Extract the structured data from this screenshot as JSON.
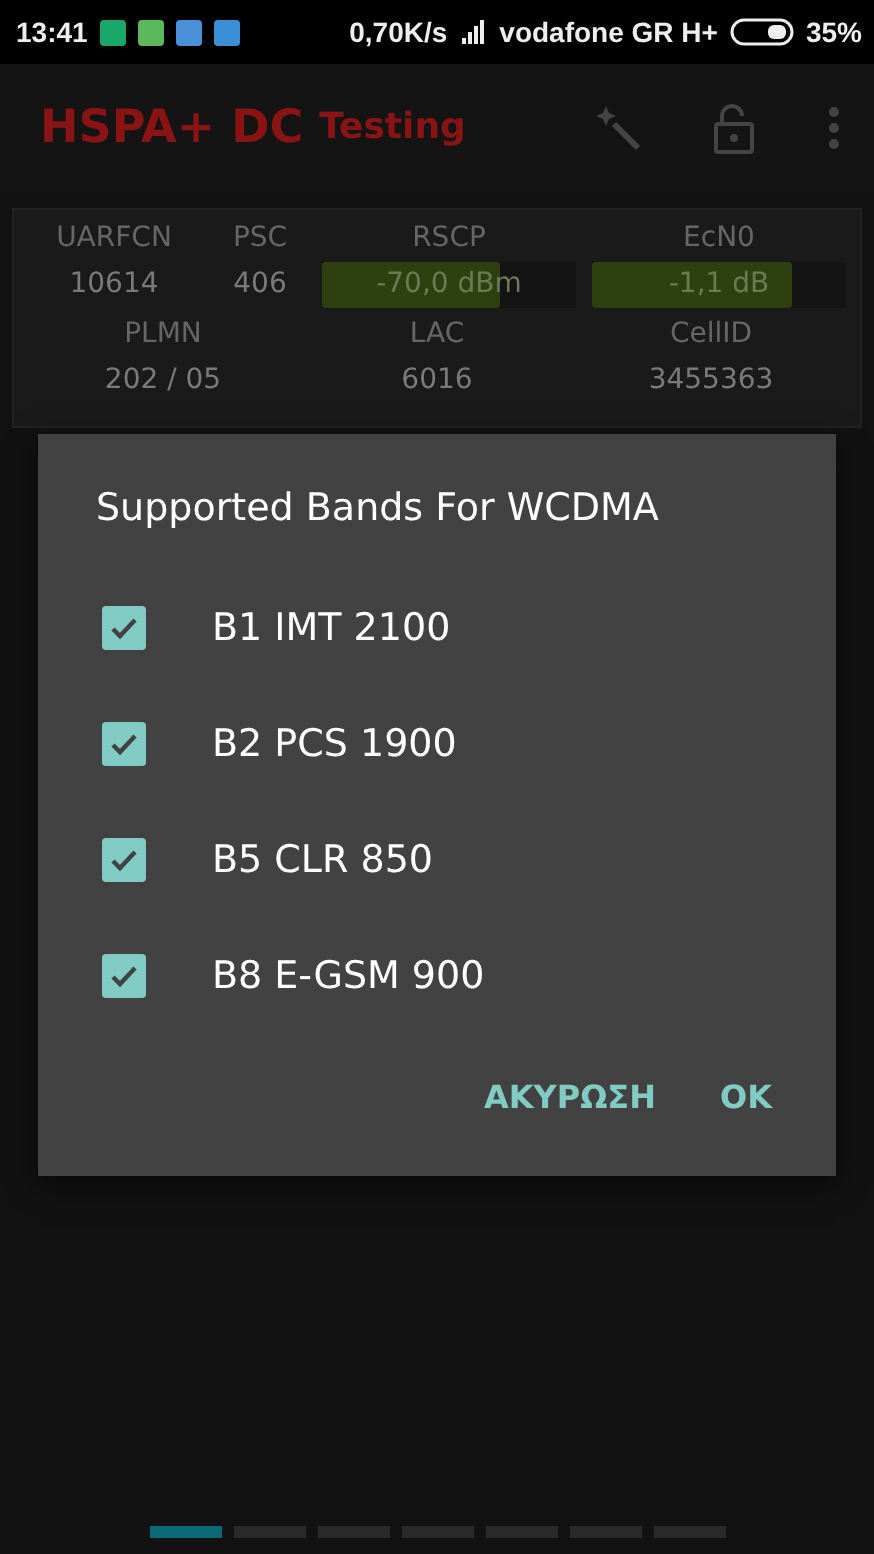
{
  "status_bar": {
    "time": "13:41",
    "speed": "0,70K/s",
    "carrier": "vodafone GR H+",
    "battery": "35%"
  },
  "app_bar": {
    "title": "HSPA+ DC",
    "subtitle": "Testing"
  },
  "cell_panel": {
    "row_1": [
      {
        "label": "UARFCN",
        "value": "10614",
        "kind": "text"
      },
      {
        "label": "PSC",
        "value": "406",
        "kind": "text"
      },
      {
        "label": "RSCP",
        "value": "-70,0 dBm",
        "kind": "meter",
        "level": 0.7
      },
      {
        "label": "EcN0",
        "value": "-1,1 dB",
        "kind": "meter",
        "level": 0.79
      }
    ],
    "row_2": [
      {
        "label": "PLMN",
        "value": "202 / 05"
      },
      {
        "label": "LAC",
        "value": "6016"
      },
      {
        "label": "CellID",
        "value": "3455363"
      }
    ]
  },
  "dialog": {
    "title": "Supported Bands For WCDMA",
    "options": [
      {
        "label": "B1 IMT 2100",
        "checked": true
      },
      {
        "label": "B2 PCS 1900",
        "checked": true
      },
      {
        "label": "B5 CLR 850",
        "checked": true
      },
      {
        "label": "B8 E-GSM 900",
        "checked": true
      }
    ],
    "buttons": [
      "ΑΚΥΡΩΣΗ",
      "OK"
    ]
  },
  "page_indicator": [
    {
      "selected": true
    },
    {
      "selected": false
    },
    {
      "selected": false
    },
    {
      "selected": false
    },
    {
      "selected": false
    },
    {
      "selected": false
    },
    {
      "selected": false
    }
  ]
}
